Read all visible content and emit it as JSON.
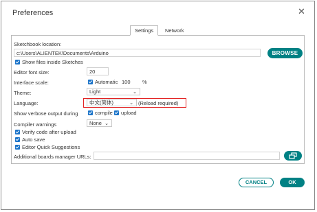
{
  "dialog": {
    "title": "Preferences"
  },
  "tabs": [
    {
      "label": "Settings"
    },
    {
      "label": "Network"
    }
  ],
  "sketchbook": {
    "label": "Sketchbook location:",
    "path": "c:\\Users\\ALIENTEK\\Documents\\Arduino",
    "browse_label": "BROWSE",
    "show_files_label": "Show files inside Sketches",
    "show_files_checked": true
  },
  "editor_font": {
    "label": "Editor font size:",
    "value": "20"
  },
  "interface_scale": {
    "label": "Interface scale:",
    "automatic_label": "Automatic",
    "automatic_checked": true,
    "value": "100",
    "unit": "%"
  },
  "theme": {
    "label": "Theme:",
    "value": "Light"
  },
  "language": {
    "label": "Language:",
    "value": "中文(简体)",
    "note": "(Reload required)"
  },
  "verbose": {
    "label": "Show verbose output during",
    "compile_label": "compile",
    "compile_checked": true,
    "upload_label": "upload",
    "upload_checked": true
  },
  "compiler_warnings": {
    "label": "Compiler warnings",
    "value": "None"
  },
  "options": [
    {
      "label": "Verify code after upload",
      "checked": true
    },
    {
      "label": "Auto save",
      "checked": true
    },
    {
      "label": "Editor Quick Suggestions",
      "checked": true
    }
  ],
  "boards_manager": {
    "label": "Additional boards manager URLs:",
    "value": "",
    "button_icon": "open-window-icon"
  },
  "footer": {
    "cancel_label": "CANCEL",
    "ok_label": "OK"
  },
  "colors": {
    "accent": "#008184",
    "checkbox": "#1a73c9",
    "highlight": "#e32222"
  }
}
